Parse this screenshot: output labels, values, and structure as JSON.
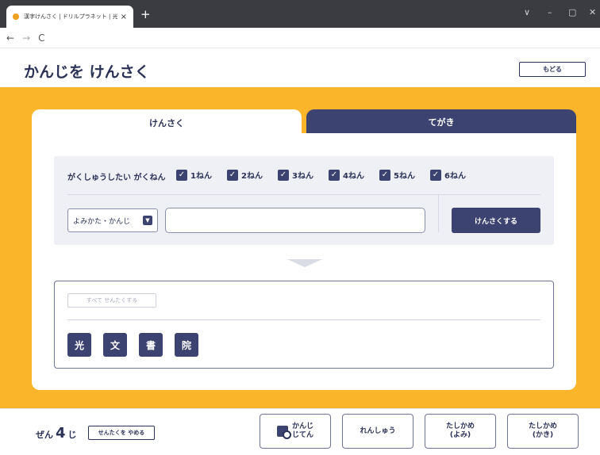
{
  "browser": {
    "tab_title": "漢字けんさく | ドリルプラネット | 光文",
    "tab_close": "×",
    "new_tab": "+",
    "nav_back": "←",
    "nav_forward": "→",
    "nav_reload": "C",
    "win_chevron": "∨",
    "win_min": "–",
    "win_max": "▢",
    "win_close": "✕"
  },
  "header": {
    "title": "かんじを けんさく",
    "back_label": "もどる"
  },
  "tabs": {
    "search": "けんさく",
    "handwriting": "てがき"
  },
  "filter": {
    "label": "がくしゅうしたい がくねん",
    "check_mark": "✓",
    "grades": [
      "1ねん",
      "2ねん",
      "3ねん",
      "4ねん",
      "5ねん",
      "6ねん"
    ]
  },
  "search": {
    "select_value": "よみかた・かんじ",
    "select_icon": "▼",
    "input_value": "",
    "button_label": "けんさくする"
  },
  "results": {
    "select_all": "すべて せんたくする",
    "kanji": [
      "光",
      "文",
      "書",
      "院"
    ]
  },
  "footer": {
    "count_prefix": "ぜん",
    "count": "4",
    "count_suffix": "じ",
    "deselect": "せんたくを やめる",
    "dictionary_line1": "かんじ",
    "dictionary_line2": "じてん",
    "practice": "れんしゅう",
    "check_reading_line1": "たしかめ",
    "check_reading_line2": "(よみ)",
    "check_writing_line1": "たしかめ",
    "check_writing_line2": "(かき)"
  },
  "colors": {
    "accent": "#fbb52b",
    "navy": "#3c4370"
  }
}
